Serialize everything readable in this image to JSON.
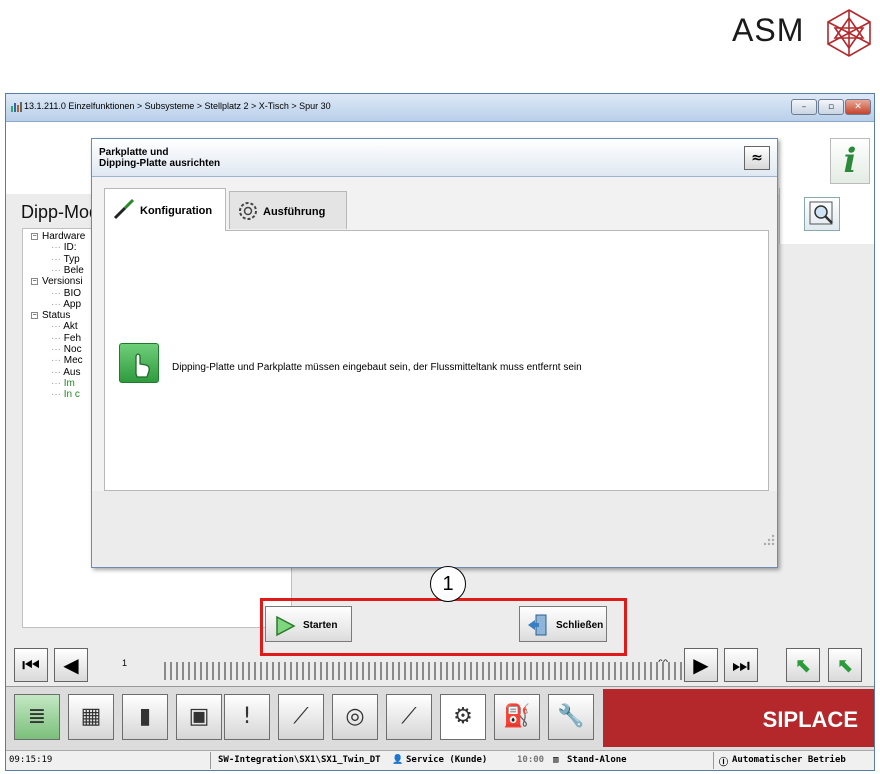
{
  "brand": {
    "logo_text": "ASM"
  },
  "window": {
    "title": "13.1.211.0 Einzelfunktionen > Subsysteme > Stellplatz 2 > X-Tisch > Spur 30",
    "buttons": {
      "minimize": "–",
      "maximize": "▫",
      "close": "✕"
    }
  },
  "info_label": "i",
  "page_title": "Dipp-Modul an Position 30-1",
  "tree": [
    {
      "label": "Hardware",
      "level": 0,
      "expander": "−"
    },
    {
      "label": "ID:",
      "level": 1
    },
    {
      "label": "Typ",
      "level": 1
    },
    {
      "label": "Bele",
      "level": 1
    },
    {
      "label": "Versionsi",
      "level": 0,
      "expander": "−"
    },
    {
      "label": "BIO",
      "level": 1
    },
    {
      "label": "App",
      "level": 1
    },
    {
      "label": "Status",
      "level": 0,
      "expander": "−"
    },
    {
      "label": "Akt",
      "level": 1
    },
    {
      "label": "Feh",
      "level": 1
    },
    {
      "label": "Noc",
      "level": 1
    },
    {
      "label": "Mec",
      "level": 1
    },
    {
      "label": "Aus",
      "level": 1
    },
    {
      "label": "Im",
      "level": 1,
      "green": true
    },
    {
      "label": "In c",
      "level": 1,
      "green": true
    }
  ],
  "dialog": {
    "title_line1": "Parkplatte und",
    "title_line2": "Dipping-Platte ausrichten",
    "collapse_glyph": "≈",
    "tabs": [
      {
        "label": "Konfiguration",
        "active": true
      },
      {
        "label": "Ausführung",
        "active": false
      }
    ],
    "hint": "Dipping-Platte und Parkplatte müssen eingebaut sein, der Flussmitteltank muss entfernt sein",
    "start_label": "Starten",
    "close_label": "Schließen"
  },
  "callout_number": "1",
  "nav": {
    "left_number": "1",
    "right_number": "60"
  },
  "toolbar": {
    "brand_label": "SIPLACE",
    "icons": [
      "stack-icon",
      "grid-icon",
      "bar-chart-icon",
      "board-icon",
      "notes-icon",
      "line-chart-icon",
      "camera-icon",
      "screwdriver-icon",
      "gear-hand-icon",
      "oil-can-icon",
      "wrench-icon"
    ]
  },
  "status": {
    "time": "09:15:19",
    "path": "SW-Integration\\SX1\\SX1_Twin_DT",
    "user": "Service (Kunde)",
    "clock2": "10:00",
    "mode": "Stand-Alone",
    "operation": "Automatischer Betrieb"
  },
  "colors": {
    "accent_red": "#b4282c",
    "highlight_frame": "#e01919",
    "tree_green": "#1d8a1d",
    "hint_green": "#3fae4c"
  }
}
